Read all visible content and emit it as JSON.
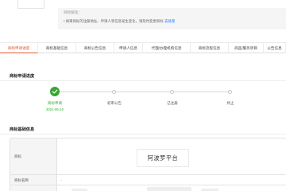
{
  "tips": {
    "title": "商标解读：",
    "body": "• 如果商标的注册地址、申请人等信息发生变化，请及时变更商标",
    "link_label": "去处理"
  },
  "tabs": [
    "商标申请进度",
    "商标基础信息",
    "商标公告信息",
    "申请人信息",
    "代理/办理机构信息",
    "商标流程信息",
    "商品/服务项目",
    "公告信息"
  ],
  "progress": {
    "heading": "商标申请进度",
    "steps": [
      {
        "label": "商标申请",
        "date": "2021-05-10",
        "done": true
      },
      {
        "label": "初审公告",
        "date": "",
        "done": false
      },
      {
        "label": "已注册",
        "date": "",
        "done": false
      },
      {
        "label": "终止",
        "date": "",
        "done": false
      }
    ]
  },
  "info": {
    "heading": "商标基础信息",
    "rows": [
      {
        "label": "商标",
        "value_logo_text": "阿波罗平台"
      },
      {
        "label": "商标名称",
        "value": "-"
      }
    ]
  },
  "colors": {
    "accent": "#e8572a",
    "done_green": "#36a72f",
    "link_blue": "#1677ff"
  }
}
